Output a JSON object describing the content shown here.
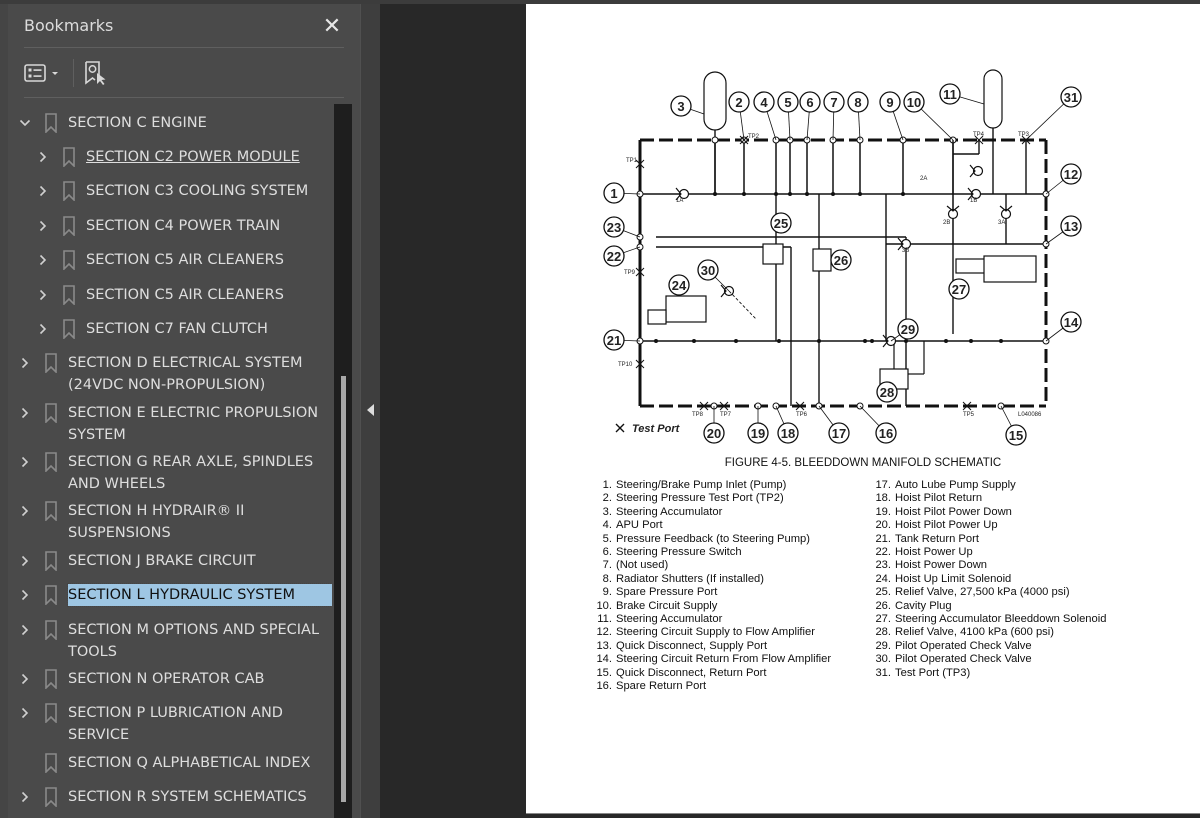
{
  "sidebar": {
    "title": "Bookmarks",
    "close_icon": "close-icon",
    "toolbar": {
      "options_icon": "list-options-icon",
      "find_bookmark_icon": "bookmark-find-icon"
    },
    "items": [
      {
        "label": "SECTION C ENGINE",
        "level": 0,
        "expand": "expanded"
      },
      {
        "label": "SECTION C2 POWER MODULE",
        "level": 1,
        "expand": "collapsed",
        "hovered": true
      },
      {
        "label": "SECTION C3 COOLING SYSTEM",
        "level": 1,
        "expand": "collapsed"
      },
      {
        "label": "SECTION C4 POWER TRAIN",
        "level": 1,
        "expand": "collapsed"
      },
      {
        "label": "SECTION C5 AIR CLEANERS",
        "level": 1,
        "expand": "collapsed"
      },
      {
        "label": "SECTION C5 AIR CLEANERS",
        "level": 1,
        "expand": "collapsed"
      },
      {
        "label": "SECTION C7 FAN CLUTCH",
        "level": 1,
        "expand": "collapsed"
      },
      {
        "label": "SECTION D ELECTRICAL SYSTEM (24VDC NON-PROPULSION)",
        "level": 0,
        "expand": "collapsed"
      },
      {
        "label": "SECTION E ELECTRIC PROPULSION SYSTEM",
        "level": 0,
        "expand": "collapsed"
      },
      {
        "label": "SECTION G REAR AXLE, SPINDLES AND WHEELS",
        "level": 0,
        "expand": "collapsed"
      },
      {
        "label": "SECTION H HYDRAIR® II SUSPENSIONS",
        "level": 0,
        "expand": "collapsed"
      },
      {
        "label": "SECTION J BRAKE CIRCUIT",
        "level": 0,
        "expand": "collapsed"
      },
      {
        "label": "SECTION L HYDRAULIC SYSTEM",
        "level": 0,
        "expand": "collapsed",
        "selected": true
      },
      {
        "label": "SECTION M OPTIONS AND SPECIAL TOOLS",
        "level": 0,
        "expand": "collapsed"
      },
      {
        "label": "SECTION N OPERATOR CAB",
        "level": 0,
        "expand": "collapsed"
      },
      {
        "label": "SECTION P LUBRICATION AND SERVICE",
        "level": 0,
        "expand": "collapsed"
      },
      {
        "label": "SECTION Q ALPHABETICAL INDEX",
        "level": 0,
        "expand": "none"
      },
      {
        "label": "SECTION R SYSTEM SCHEMATICS",
        "level": 0,
        "expand": "collapsed"
      }
    ]
  },
  "splitter": {
    "collapse_icon": "collapse-panel-arrow-icon"
  },
  "document": {
    "figure": {
      "caption": "FIGURE 4-5. BLEEDDOWN MANIFOLD SCHEMATIC",
      "test_port_legend": "Test Port",
      "drawing_id": "L040086",
      "callouts": [
        "1",
        "2",
        "3",
        "4",
        "5",
        "6",
        "7",
        "8",
        "9",
        "10",
        "11",
        "12",
        "13",
        "14",
        "15",
        "16",
        "17",
        "18",
        "19",
        "20",
        "21",
        "22",
        "23",
        "24",
        "25",
        "26",
        "27",
        "28",
        "29",
        "30",
        "31"
      ],
      "test_port_labels": [
        "TP1",
        "TP2",
        "TP3",
        "TP4",
        "TP5",
        "TP6",
        "TP7",
        "TP8",
        "TP9",
        "TP10"
      ],
      "valve_labels": [
        "1A",
        "1B",
        "2A",
        "2B",
        "3A",
        "3B"
      ]
    },
    "legend_left": [
      {
        "n": "1.",
        "t": "Steering/Brake Pump Inlet (Pump)"
      },
      {
        "n": "2.",
        "t": "Steering Pressure Test Port (TP2)"
      },
      {
        "n": "3.",
        "t": "Steering Accumulator"
      },
      {
        "n": "4.",
        "t": "APU Port"
      },
      {
        "n": "5.",
        "t": "Pressure Feedback (to Steering Pump)"
      },
      {
        "n": "6.",
        "t": "Steering Pressure Switch"
      },
      {
        "n": "7.",
        "t": "(Not used)"
      },
      {
        "n": "8.",
        "t": "Radiator Shutters (If installed)"
      },
      {
        "n": "9.",
        "t": "Spare Pressure Port"
      },
      {
        "n": "10.",
        "t": "Brake Circuit Supply"
      },
      {
        "n": "11.",
        "t": "Steering Accumulator"
      },
      {
        "n": "12.",
        "t": "Steering Circuit Supply to Flow Amplifier"
      },
      {
        "n": "13.",
        "t": "Quick Disconnect, Supply Port"
      },
      {
        "n": "14.",
        "t": "Steering Circuit Return From Flow Amplifier"
      },
      {
        "n": "15.",
        "t": "Quick Disconnect, Return Port"
      },
      {
        "n": "16.",
        "t": "Spare Return Port"
      }
    ],
    "legend_right": [
      {
        "n": "17.",
        "t": "Auto Lube Pump Supply"
      },
      {
        "n": "18.",
        "t": "Hoist Pilot Return"
      },
      {
        "n": "19.",
        "t": "Hoist Pilot Power Down"
      },
      {
        "n": "20.",
        "t": "Hoist Pilot Power Up"
      },
      {
        "n": "21.",
        "t": "Tank Return Port"
      },
      {
        "n": "22.",
        "t": "Hoist Power Up"
      },
      {
        "n": "23.",
        "t": "Hoist Power Down"
      },
      {
        "n": "24.",
        "t": "Hoist Up Limit Solenoid"
      },
      {
        "n": "25.",
        "t": "Relief Valve, 27,500 kPa (4000 psi)"
      },
      {
        "n": "26.",
        "t": "Cavity Plug"
      },
      {
        "n": "27.",
        "t": "Steering Accumulator Bleeddown Solenoid"
      },
      {
        "n": "28.",
        "t": "Relief Valve, 4100 kPa (600 psi)"
      },
      {
        "n": "29.",
        "t": "Pilot Operated Check Valve"
      },
      {
        "n": "30.",
        "t": "Pilot Operated Check Valve"
      },
      {
        "n": "31.",
        "t": "Test Port (TP3)"
      }
    ]
  },
  "colors": {
    "panel_bg": "#4a4a4a",
    "viewer_bg": "#282828",
    "selection_bg": "#9ec6e3",
    "text": "#dedede"
  }
}
